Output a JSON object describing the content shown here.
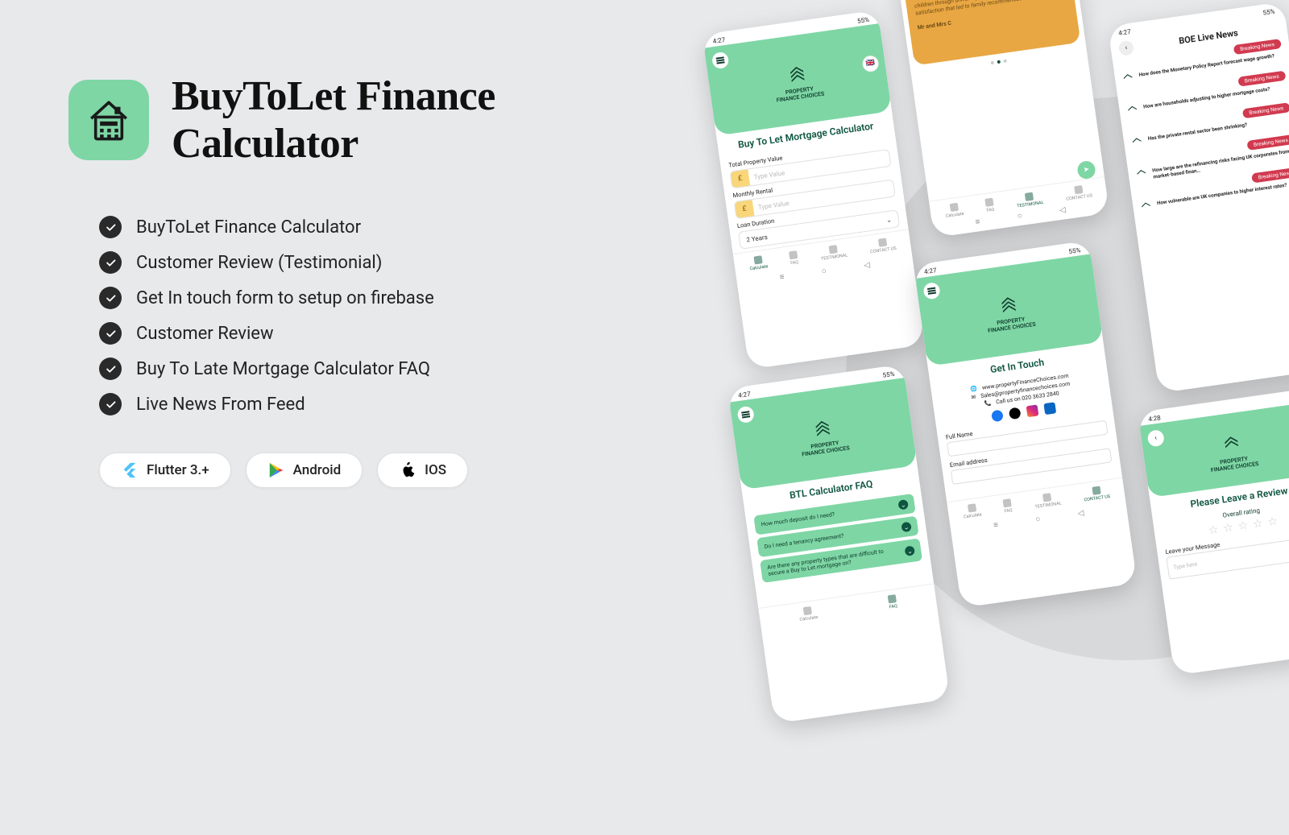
{
  "hero": {
    "title": "BuyToLet Finance Calculator"
  },
  "features": [
    "BuyToLet Finance Calculator",
    "Customer Review (Testimonial)",
    "Get In touch form to setup on firebase",
    "Customer Review",
    "Buy To Late Mortgage Calculator FAQ",
    "Live News From Feed"
  ],
  "tech": {
    "flutter": "Flutter 3.+",
    "android": "Android",
    "ios": "IOS"
  },
  "phone_shared": {
    "status_time": "4:27",
    "status_right": "55%",
    "status_time_alt": "4:28",
    "brand_line1": "PROPERTY",
    "brand_line2": "FINANCE CHOICES",
    "nav": {
      "calculate": "Calculate",
      "faq": "FAQ",
      "testimonial": "TESTIMONAL",
      "contact": "CONTACT US"
    }
  },
  "calculator": {
    "title": "Buy To Let Mortgage Calculator",
    "fields": {
      "total_property_label": "Total Property Value",
      "monthly_rental_label": "Monthly Rental",
      "loan_duration_label": "Loan Duration",
      "placeholder": "Type Value",
      "currency_symbol": "£",
      "loan_duration_value": "2 Years"
    }
  },
  "faq": {
    "title": "BTL Calculator FAQ",
    "items": [
      "How much deposit do I need?",
      "Do I need a tenancy agreement?",
      "Are there any property types that are difficult to secure a Buy to Let mortgage on?"
    ]
  },
  "testimonial": {
    "body": "Refinancing their mortgage-free residence enabled Mr. and Mrs. C. to expand their buy-to-let portfolio, supporting their children through university and garnering long-term satisfaction that led to family recommendations.",
    "author": "Mr and Mrs C"
  },
  "contact": {
    "title": "Get In Touch",
    "website": "www.propertyFinanceChoices.com",
    "email": "Sales@propertyfinancechoices.com",
    "phone": "Call us on 020 3633 2840",
    "fullname_label": "Full Name",
    "email_label": "Email address"
  },
  "news": {
    "title": "BOE Live News",
    "badge": "Breaking News",
    "items": [
      "How does the Monetary Policy Report forecast wage growth?",
      "How are households adjusting to higher mortgage costs?",
      "Has the private rental sector been shrinking?",
      "How large are the refinancing risks facing UK corporates from market-based finan…",
      "How vulnerable are UK companies to higher interest rates?"
    ]
  },
  "review": {
    "title": "Please Leave a Review",
    "overall": "Overall rating",
    "leave": "Leave your Message",
    "placeholder": "Type here"
  }
}
